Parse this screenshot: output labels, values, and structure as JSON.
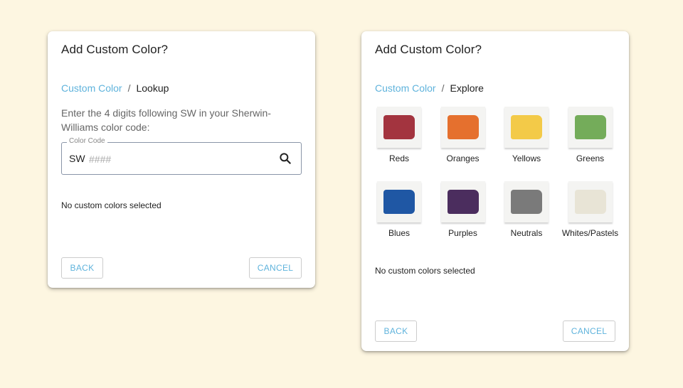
{
  "lookup_dialog": {
    "title": "Add Custom Color?",
    "breadcrumb": {
      "parent": "Custom Color",
      "separator": "/",
      "current": "Lookup"
    },
    "instructions": "Enter the 4 digits following SW in your Sherwin-Williams color code:",
    "field": {
      "label": "Color Code",
      "prefix": "SW",
      "value": "",
      "placeholder": "####",
      "icon": "search-icon"
    },
    "status": "No custom colors selected",
    "back_label": "BACK",
    "cancel_label": "CANCEL"
  },
  "explore_dialog": {
    "title": "Add Custom Color?",
    "breadcrumb": {
      "parent": "Custom Color",
      "separator": "/",
      "current": "Explore"
    },
    "swatches": [
      {
        "label": "Reds",
        "color": "#a3343f"
      },
      {
        "label": "Oranges",
        "color": "#e5702e"
      },
      {
        "label": "Yellows",
        "color": "#f3ca48"
      },
      {
        "label": "Greens",
        "color": "#74ac5a"
      },
      {
        "label": "Blues",
        "color": "#1f57a4"
      },
      {
        "label": "Purples",
        "color": "#4b2d5e"
      },
      {
        "label": "Neutrals",
        "color": "#7a7a7a"
      },
      {
        "label": "Whites/Pastels",
        "color": "#e8e4d6"
      }
    ],
    "status": "No custom colors selected",
    "back_label": "BACK",
    "cancel_label": "CANCEL"
  },
  "colors": {
    "accent": "#5fb3dc",
    "background": "#fdf6e1"
  }
}
